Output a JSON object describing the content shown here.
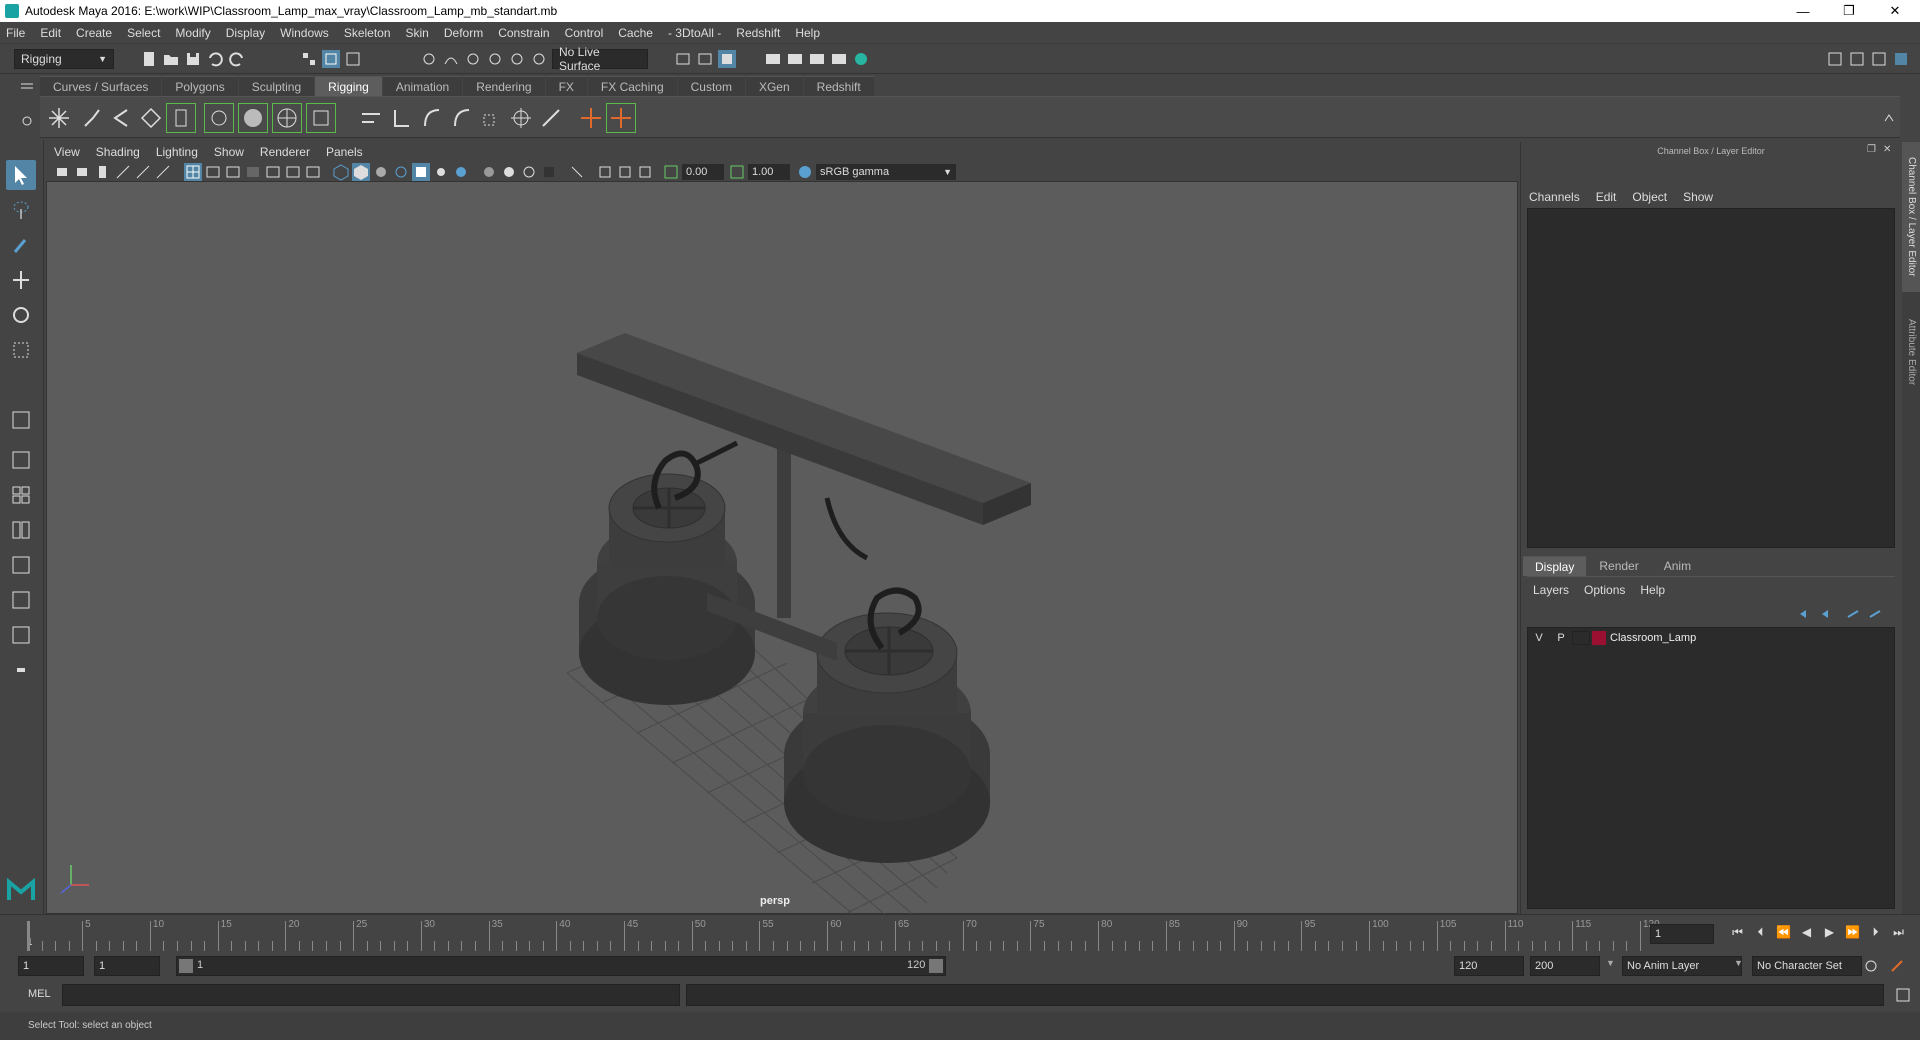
{
  "window": {
    "title": "Autodesk Maya 2016: E:\\work\\WIP\\Classroom_Lamp_max_vray\\Classroom_Lamp_mb_standart.mb",
    "minimize": "—",
    "maximize": "❐",
    "close": "✕"
  },
  "menu": [
    "File",
    "Edit",
    "Create",
    "Select",
    "Modify",
    "Display",
    "Windows",
    "Skeleton",
    "Skin",
    "Deform",
    "Constrain",
    "Control",
    "Cache",
    "- 3DtoAll -",
    "Redshift",
    "Help"
  ],
  "statusline": {
    "mode": "Rigging",
    "live_surface": "No Live Surface"
  },
  "shelf": {
    "tabs": [
      "Curves / Surfaces",
      "Polygons",
      "Sculpting",
      "Rigging",
      "Animation",
      "Rendering",
      "FX",
      "FX Caching",
      "Custom",
      "XGen",
      "Redshift"
    ],
    "active": "Rigging"
  },
  "viewport": {
    "menu": [
      "View",
      "Shading",
      "Lighting",
      "Show",
      "Renderer",
      "Panels"
    ],
    "exposure": "0.00",
    "gamma": "1.00",
    "color_space": "sRGB gamma",
    "camera": "persp"
  },
  "channelbox": {
    "title": "Channel Box / Layer Editor",
    "menu": [
      "Channels",
      "Edit",
      "Object",
      "Show"
    ],
    "side_tab_1": "Channel Box / Layer Editor",
    "side_tab_2": "Attribute Editor"
  },
  "layereditor": {
    "tabs": [
      "Display",
      "Render",
      "Anim"
    ],
    "active": "Display",
    "menu": [
      "Layers",
      "Options",
      "Help"
    ],
    "layers": [
      {
        "v": "V",
        "p": "P",
        "name": "Classroom_Lamp",
        "color": "#9b1030"
      }
    ]
  },
  "timeline": {
    "ticks": [
      "5",
      "10",
      "15",
      "20",
      "25",
      "30",
      "35",
      "40",
      "45",
      "50",
      "55",
      "60",
      "65",
      "70",
      "75",
      "80",
      "85",
      "90",
      "95",
      "100",
      "105",
      "110",
      "115",
      "120"
    ],
    "start_label": "1",
    "current_frame": "1"
  },
  "range": {
    "start": "1",
    "playback_start": "1",
    "slider_start": "1",
    "slider_end": "120",
    "playback_end": "120",
    "end": "200",
    "anim_layer": "No Anim Layer",
    "character_set": "No Character Set"
  },
  "command": {
    "lang": "MEL"
  },
  "help": {
    "text": "Select Tool: select an object"
  }
}
